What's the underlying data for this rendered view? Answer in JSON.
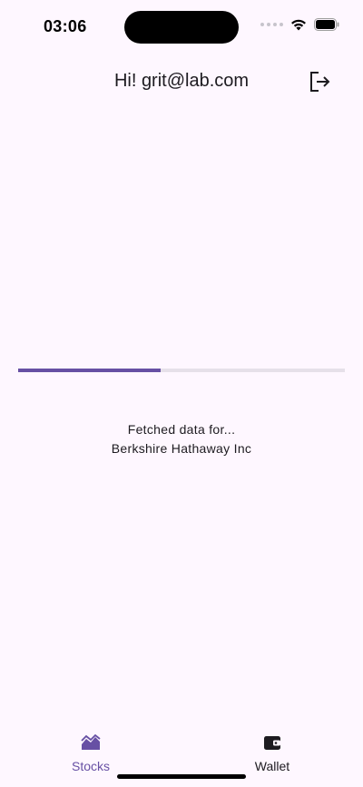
{
  "status_bar": {
    "time": "03:06",
    "icons": [
      "signal-icon",
      "wifi-icon",
      "battery-icon"
    ]
  },
  "header": {
    "title": "Hi! grit@lab.com",
    "logout_icon": "logout-icon"
  },
  "loading": {
    "progress": 0.435,
    "line1": "Fetched data for...",
    "line2": "Berkshire Hathaway Inc"
  },
  "bottom_nav": {
    "items": [
      {
        "label": "Stocks",
        "icon": "stocks-icon",
        "selected": true
      },
      {
        "label": "Wallet",
        "icon": "wallet-icon",
        "selected": false
      }
    ]
  },
  "colors": {
    "background": "#fef7ff",
    "accent": "#6750a4",
    "track": "#e6e0e9",
    "text": "#1d1b20"
  }
}
